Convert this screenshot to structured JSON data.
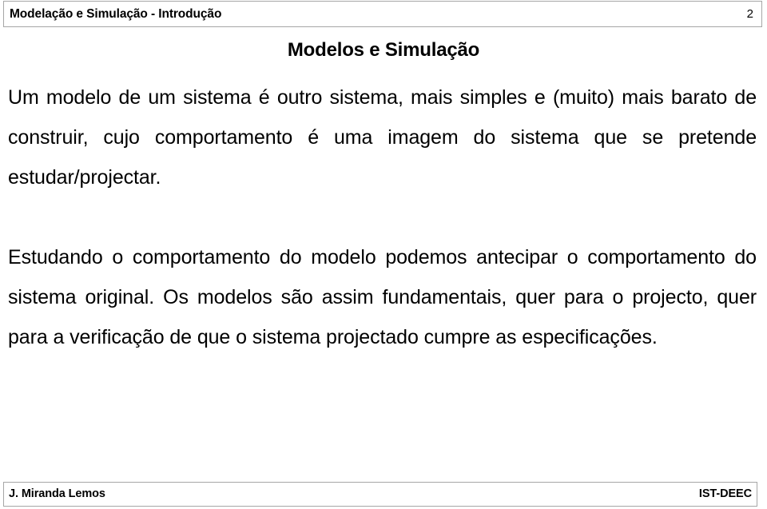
{
  "slide": {
    "page_number": "2",
    "background_color": "#ffffff",
    "text_color": "#000000",
    "border_color": "#a6a6a6"
  },
  "header": {
    "title": "Modelação e Simulação - Introdução",
    "page_number": "2"
  },
  "title": {
    "text": "Modelos e Simulação"
  },
  "body": {
    "paragraphs": [
      "Um modelo de um sistema é outro sistema, mais simples e (muito) mais barato de construir, cujo comportamento é uma imagem do sistema que se pretende estudar/projectar.",
      "Estudando o comportamento do modelo podemos antecipar o comportamento do sistema original. Os modelos são assim fundamentais, quer para o projecto, quer para a verificação de que o sistema projectado cumpre as especificações."
    ]
  },
  "footer": {
    "author": "J. Miranda Lemos",
    "organization": "IST-DEEC"
  }
}
